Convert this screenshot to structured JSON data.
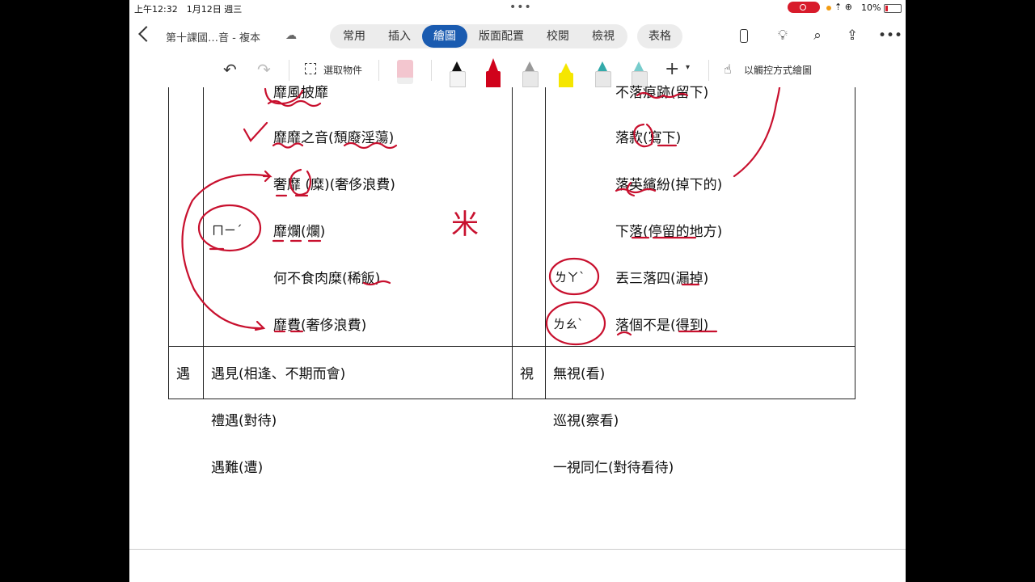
{
  "status_bar": {
    "time": "上午12:32　1月12日 週三",
    "battery": "10%",
    "wifi": "⇡ ⊕"
  },
  "title_bar": {
    "doc_title": "第十課國…音 - 複本",
    "tabs": [
      "常用",
      "插入",
      "繪圖",
      "版面配置",
      "校閱",
      "檢視"
    ],
    "active_tab": "繪圖",
    "extra_tab": "表格"
  },
  "draw_toolbar": {
    "select_label": "選取物件",
    "touch_label": "以觸控方式繪圖"
  },
  "colors": {
    "accent": "#1a5bb0",
    "ink": "#c8102e"
  },
  "document": {
    "left_col": [
      "靡風披靡",
      "靡靡之音(頹廢淫蕩)",
      "奢靡 (糜)(奢侈浪費)",
      "靡爛(爛)",
      "何不食肉糜(稀飯)",
      "靡費(奢侈浪費)"
    ],
    "right_col": [
      "不落痕跡(留下)",
      "落款(寫下)",
      "落英繽紛(掉下的)",
      "下落(停留的地方)",
      "丟三落四(漏掉)",
      "落個不是(得到)"
    ],
    "phonetics": {
      "left_mi": "ㄇㄧˊ",
      "right_la": "ㄌㄚˋ",
      "right_lao": "ㄌㄠˋ"
    },
    "ink_mark": "米",
    "row2": {
      "char_left": "遇",
      "left_items": [
        "遇見(相逢、不期而會)",
        "禮遇(對待)",
        "遇難(遭)"
      ],
      "char_right": "視",
      "right_items": [
        "無視(看)",
        "巡視(察看)",
        "一視同仁(對待看待)"
      ]
    }
  }
}
